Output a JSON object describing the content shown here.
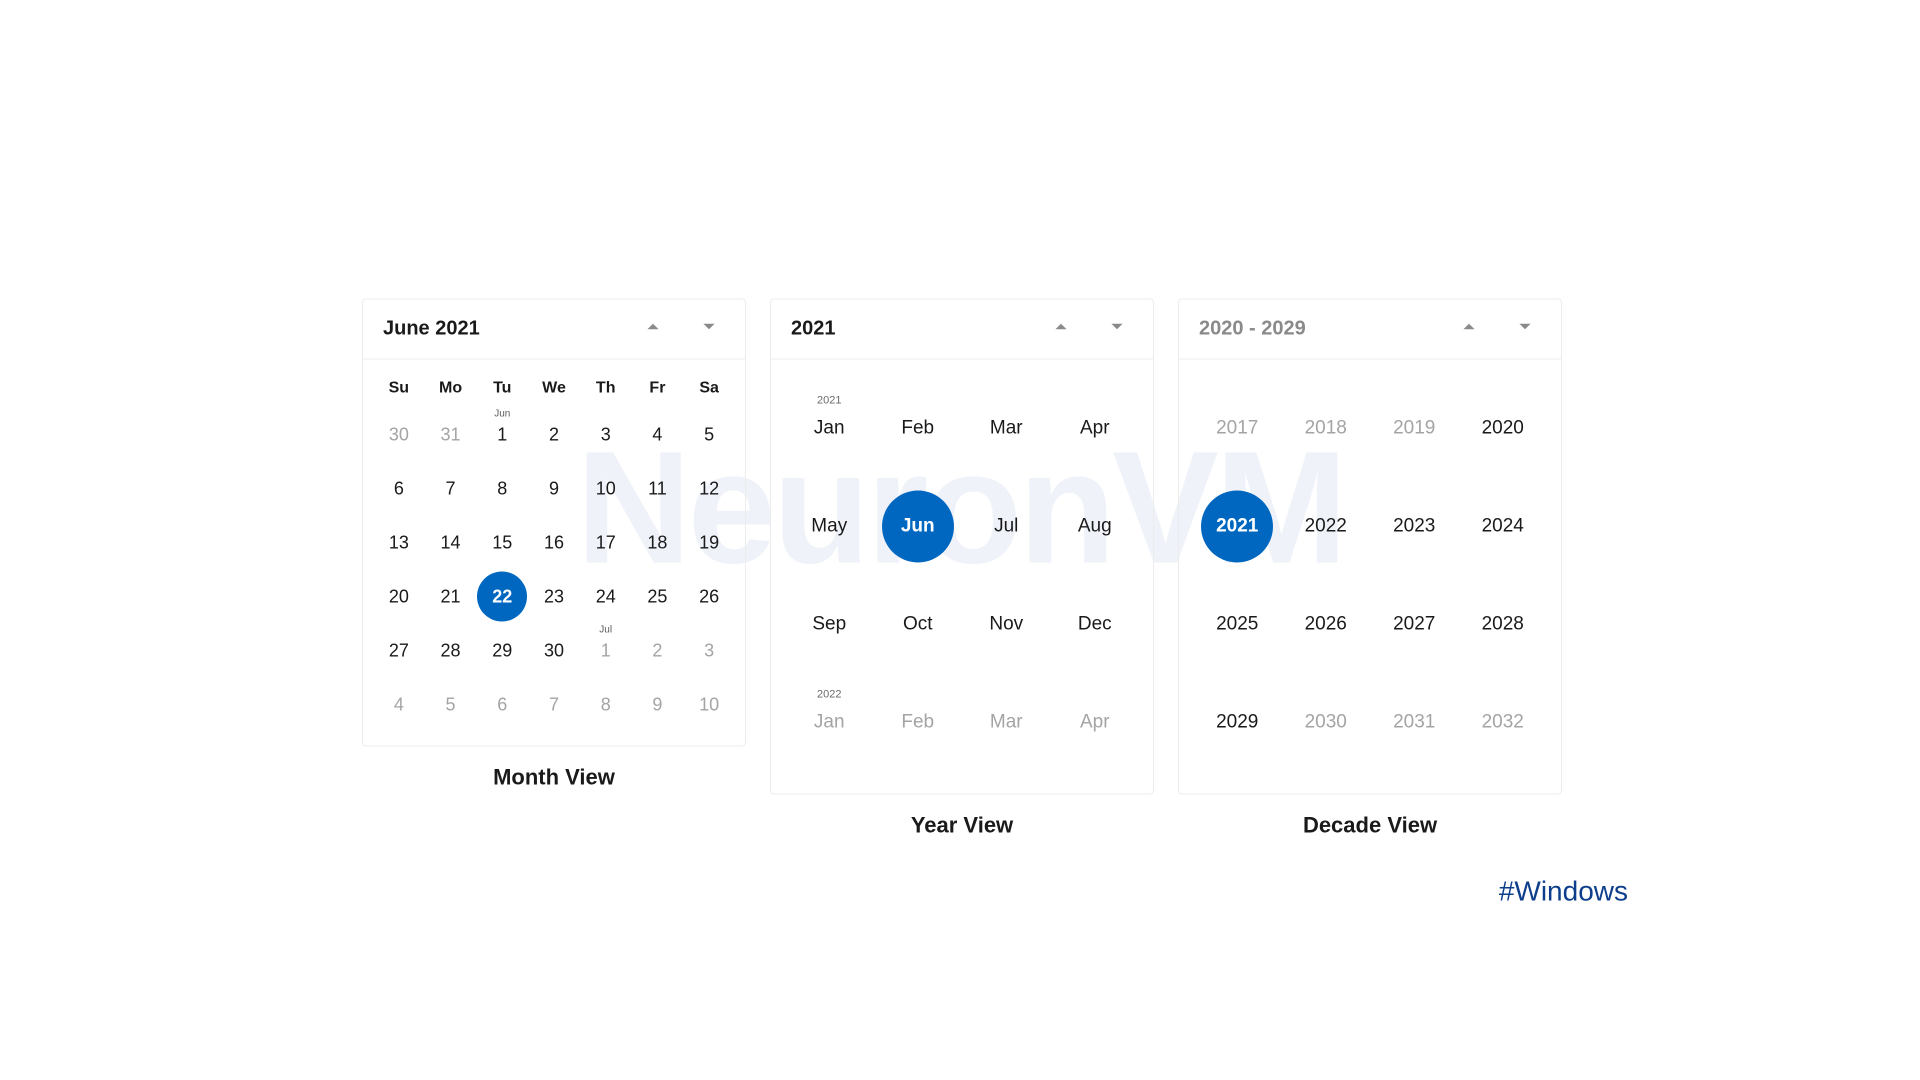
{
  "watermark": "NeuronVM",
  "hashtag": "#Windows",
  "month_view": {
    "title": "June 2021",
    "caption": "Month View",
    "dow": [
      "Su",
      "Mo",
      "Tu",
      "We",
      "Th",
      "Fr",
      "Sa"
    ],
    "days": [
      {
        "n": "30",
        "muted": true
      },
      {
        "n": "31",
        "muted": true
      },
      {
        "n": "1",
        "tag": "Jun"
      },
      {
        "n": "2"
      },
      {
        "n": "3"
      },
      {
        "n": "4"
      },
      {
        "n": "5"
      },
      {
        "n": "6"
      },
      {
        "n": "7"
      },
      {
        "n": "8"
      },
      {
        "n": "9"
      },
      {
        "n": "10"
      },
      {
        "n": "11"
      },
      {
        "n": "12"
      },
      {
        "n": "13"
      },
      {
        "n": "14"
      },
      {
        "n": "15"
      },
      {
        "n": "16"
      },
      {
        "n": "17"
      },
      {
        "n": "18"
      },
      {
        "n": "19"
      },
      {
        "n": "20"
      },
      {
        "n": "21"
      },
      {
        "n": "22",
        "selected": true
      },
      {
        "n": "23"
      },
      {
        "n": "24"
      },
      {
        "n": "25"
      },
      {
        "n": "26"
      },
      {
        "n": "27"
      },
      {
        "n": "28"
      },
      {
        "n": "29"
      },
      {
        "n": "30"
      },
      {
        "n": "1",
        "tag": "Jul",
        "muted": true
      },
      {
        "n": "2",
        "muted": true
      },
      {
        "n": "3",
        "muted": true
      },
      {
        "n": "4",
        "muted": true
      },
      {
        "n": "5",
        "muted": true
      },
      {
        "n": "6",
        "muted": true
      },
      {
        "n": "7",
        "muted": true
      },
      {
        "n": "8",
        "muted": true
      },
      {
        "n": "9",
        "muted": true
      },
      {
        "n": "10",
        "muted": true
      }
    ]
  },
  "year_view": {
    "title": "2021",
    "caption": "Year View",
    "cells": [
      {
        "l": "Jan",
        "tag": "2021"
      },
      {
        "l": "Feb"
      },
      {
        "l": "Mar"
      },
      {
        "l": "Apr"
      },
      {
        "l": "May"
      },
      {
        "l": "Jun",
        "selected": true
      },
      {
        "l": "Jul"
      },
      {
        "l": "Aug"
      },
      {
        "l": "Sep"
      },
      {
        "l": "Oct"
      },
      {
        "l": "Nov"
      },
      {
        "l": "Dec"
      },
      {
        "l": "Jan",
        "tag": "2022",
        "muted": true
      },
      {
        "l": "Feb",
        "muted": true
      },
      {
        "l": "Mar",
        "muted": true
      },
      {
        "l": "Apr",
        "muted": true
      }
    ]
  },
  "decade_view": {
    "title": "2020 - 2029",
    "caption": "Decade View",
    "cells": [
      {
        "l": "2017",
        "muted": true
      },
      {
        "l": "2018",
        "muted": true
      },
      {
        "l": "2019",
        "muted": true
      },
      {
        "l": "2020"
      },
      {
        "l": "2021",
        "selected": true
      },
      {
        "l": "2022"
      },
      {
        "l": "2023"
      },
      {
        "l": "2024"
      },
      {
        "l": "2025"
      },
      {
        "l": "2026"
      },
      {
        "l": "2027"
      },
      {
        "l": "2028"
      },
      {
        "l": "2029"
      },
      {
        "l": "2030",
        "muted": true
      },
      {
        "l": "2031",
        "muted": true
      },
      {
        "l": "2032",
        "muted": true
      }
    ]
  }
}
